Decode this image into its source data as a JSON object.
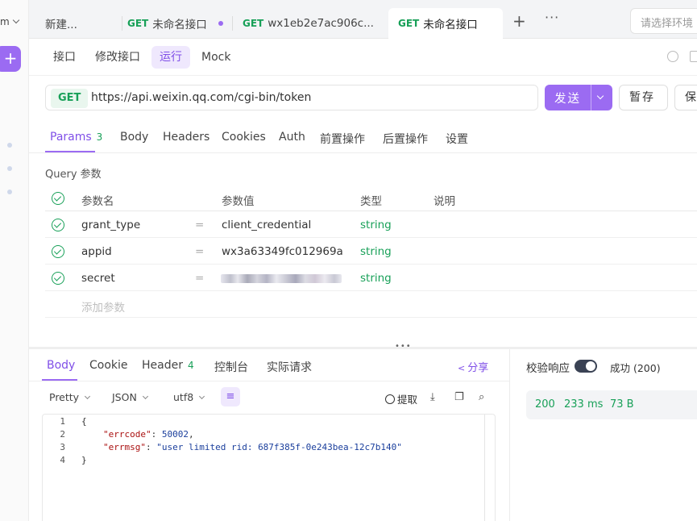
{
  "sidebar": {
    "workspace_label": "m",
    "add_label": "+"
  },
  "tabs": [
    {
      "method": "",
      "label": "新建...",
      "active": false
    },
    {
      "method": "GET",
      "label": "未命名接口",
      "active": false,
      "unsaved": true
    },
    {
      "method": "GET",
      "label": "wx1eb2e7ac906c...",
      "active": false
    },
    {
      "method": "GET",
      "label": "未命名接口",
      "active": true
    }
  ],
  "tabbar": {
    "add_label": "+",
    "more_label": "···",
    "env_placeholder": "请选择环境"
  },
  "subtabs": [
    "接口",
    "修改接口",
    "运行",
    "Mock"
  ],
  "request": {
    "method": "GET",
    "url": "https://api.weixin.qq.com/cgi-bin/token",
    "send_label": "发送",
    "save_temp_label": "暂存",
    "save_label": "保存"
  },
  "request_tabs": {
    "params": "Params",
    "params_count": "3",
    "body": "Body",
    "headers": "Headers",
    "cookies": "Cookies",
    "auth": "Auth",
    "pre": "前置操作",
    "post": "后置操作",
    "settings": "设置"
  },
  "query": {
    "title": "Query 参数",
    "columns": [
      "参数名",
      "参数值",
      "类型",
      "说明"
    ],
    "rows": [
      {
        "name": "grant_type",
        "value": "client_credential",
        "type": "string"
      },
      {
        "name": "appid",
        "value": "wx3a63349fc012969a",
        "type": "string"
      },
      {
        "name": "secret",
        "value": "",
        "type": "string",
        "masked": true
      }
    ],
    "add_placeholder": "添加参数",
    "eq": "="
  },
  "response": {
    "tabs": {
      "body": "Body",
      "cookie": "Cookie",
      "header": "Header",
      "header_count": "4",
      "console": "控制台",
      "actual": "实际请求"
    },
    "share_label": "分享",
    "format": {
      "pretty": "Pretty",
      "json": "JSON",
      "encoding": "utf8"
    },
    "extract_label": "提取",
    "code_lines": [
      {
        "n": "1",
        "text": "{"
      },
      {
        "n": "2",
        "key": "\"errcode\"",
        "sep": ": ",
        "val": "50002",
        "end": ","
      },
      {
        "n": "3",
        "key": "\"errmsg\"",
        "sep": ": ",
        "val": "\"user limited rid: 687f385f-0e243bea-12c7b140\"",
        "end": ""
      },
      {
        "n": "4",
        "text": "}"
      }
    ],
    "validate_label": "校验响应",
    "status_text": "成功 (200)",
    "metrics": {
      "code": "200",
      "time": "233 ms",
      "size": "73 B"
    }
  },
  "colors": {
    "accent": "#9b6bf2",
    "get_method": "#18a058",
    "active_tab_bg": "#efe8fd"
  }
}
